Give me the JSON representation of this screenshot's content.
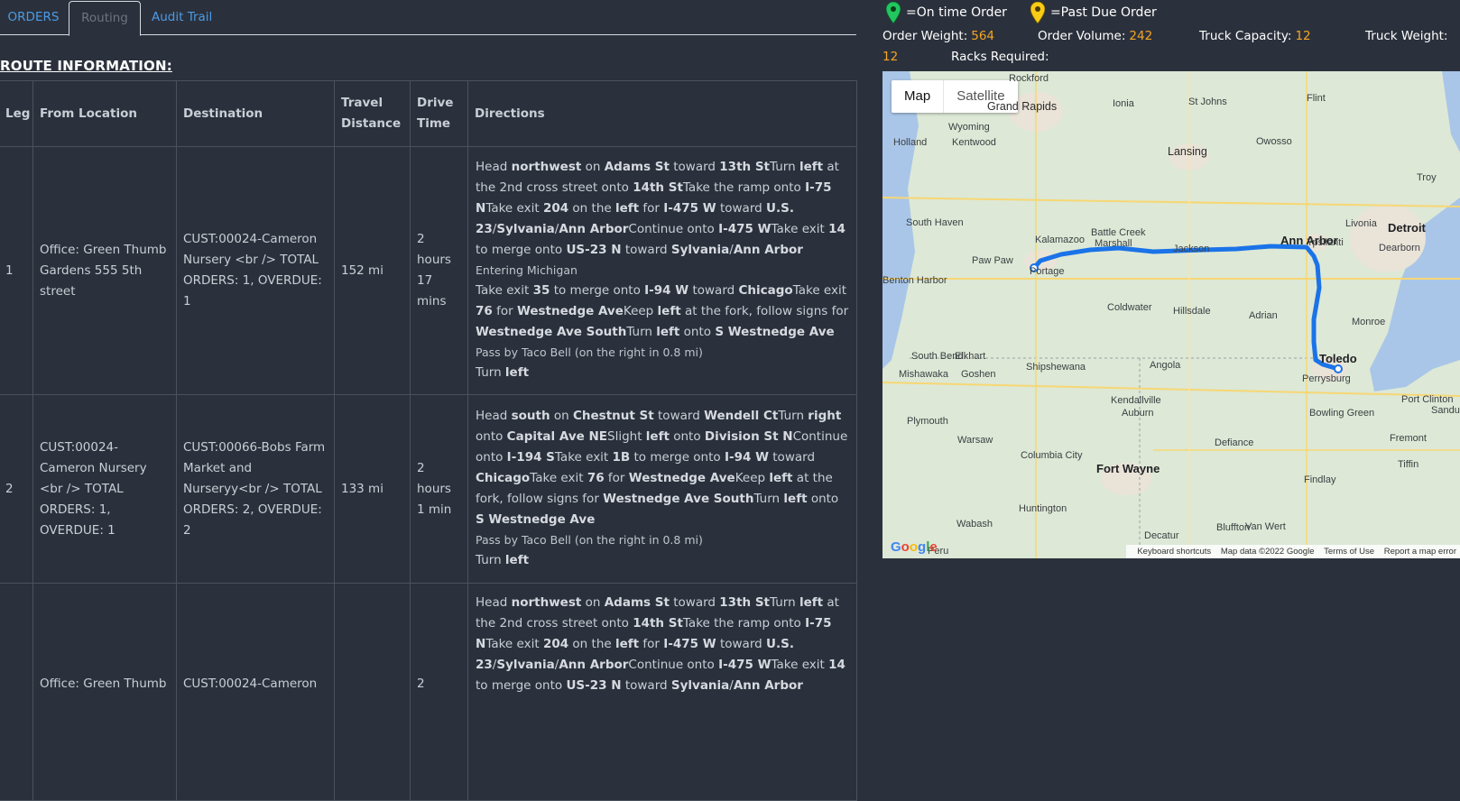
{
  "tabs": {
    "orders": "ORDERS",
    "routing": "Routing",
    "audit": "Audit Trail"
  },
  "section_title": "ROUTE INFORMATION:",
  "table": {
    "headers": {
      "leg": "Leg",
      "from": "From Location",
      "dest": "Destination",
      "distance": "Travel Distance",
      "drive": "Drive Time",
      "directions": "Directions"
    },
    "rows": [
      {
        "leg": "1",
        "from": "Office: Green Thumb Gardens 555 5th street",
        "dest": "CUST:00024-Cameron Nursery <br /> TOTAL ORDERS: 1, OVERDUE: 1",
        "distance": "152 mi",
        "drive": "2 hours 17 mins",
        "entering": "Entering Michigan",
        "pass_by": "Pass by Taco Bell (on the right in 0.8 mi)",
        "turn_left": "Turn left"
      },
      {
        "leg": "2",
        "from": "CUST:00024-Cameron Nursery <br /> TOTAL ORDERS: 1, OVERDUE: 1",
        "dest": "CUST:00066-Bobs Farm Market and Nurseryy<br /> TOTAL ORDERS: 2, OVERDUE: 2",
        "distance": "133 mi",
        "drive": "2 hours 1 min",
        "pass_by": "Pass by Taco Bell (on the right in 0.8 mi)",
        "turn_left": "Turn left"
      },
      {
        "leg": "",
        "from": "Office: Green Thumb",
        "dest": "CUST:00024-Cameron",
        "distance": "",
        "drive": "2"
      }
    ]
  },
  "legend": {
    "on_time": "=On time Order",
    "past_due": "=Past Due Order"
  },
  "stats": {
    "order_weight_label": "Order Weight:",
    "order_weight": "564",
    "order_volume_label": "Order Volume:",
    "order_volume": "242",
    "truck_capacity_label": "Truck Capacity:",
    "truck_capacity": "12",
    "truck_weight_label": "Truck Weight:",
    "truck_weight": "12",
    "racks_label": "Racks Required:"
  },
  "map": {
    "map_btn": "Map",
    "satellite_btn": "Satellite",
    "cities": [
      "Grand Rapids",
      "Lansing",
      "Flint",
      "Detroit",
      "Ann Arbor",
      "Kalamazoo",
      "Battle Creek",
      "Marshall",
      "Jackson",
      "Toledo",
      "Fort Wayne",
      "Portage",
      "South Bend",
      "Coldwater",
      "Hillsdale",
      "Adrian",
      "Angola",
      "Findlay",
      "Columbia City",
      "Warsaw",
      "Huntington",
      "Wabash",
      "Bowling Green",
      "Perrysburg",
      "Defiance",
      "Auburn",
      "Kendallville",
      "Elkhart",
      "Mishawaka",
      "Goshen",
      "Plymouth",
      "Holland",
      "Kentwood",
      "Wyoming",
      "Ionia",
      "St Johns",
      "Owosso",
      "Livonia",
      "Dearborn",
      "Troy",
      "Ypsilanti",
      "Monroe",
      "Paw Paw",
      "Shipshewana",
      "Van Wert",
      "Decatur",
      "Bluffton",
      "Fremont",
      "Tiffin",
      "Port Clinton",
      "South Haven",
      "Benton Harbor",
      "Peru",
      "Rockford",
      "Sandusky"
    ],
    "footer_shortcuts": "Keyboard shortcuts",
    "footer_data": "Map data ©2022 Google",
    "footer_terms": "Terms of Use",
    "footer_report": "Report a map error",
    "google": "Google"
  },
  "colors": {
    "background": "#2b313c",
    "link": "#4c9be6",
    "accent": "#f5a623",
    "route": "#1a73e8",
    "on_time_pin": "#22c55e",
    "past_due_pin": "#facc15"
  }
}
